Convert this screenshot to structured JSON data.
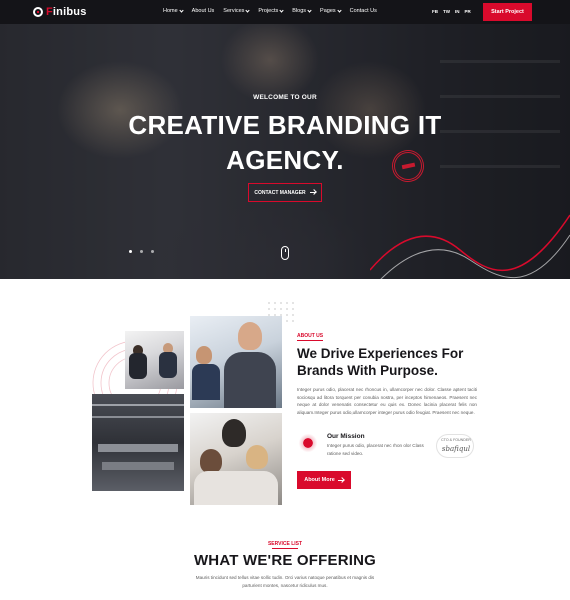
{
  "nav": {
    "brand_prefix": "F",
    "brand_rest": "inibus",
    "menu": [
      {
        "label": "Home",
        "has_dropdown": true
      },
      {
        "label": "About Us",
        "has_dropdown": false
      },
      {
        "label": "Services",
        "has_dropdown": true
      },
      {
        "label": "Projects",
        "has_dropdown": true
      },
      {
        "label": "Blogs",
        "has_dropdown": true
      },
      {
        "label": "Pages",
        "has_dropdown": true
      },
      {
        "label": "Contact Us",
        "has_dropdown": false
      }
    ],
    "social": [
      "FB",
      "TW",
      "IN",
      "PR"
    ],
    "cta_label": "Start Project"
  },
  "hero": {
    "welcome": "WELCOME TO OUR",
    "title_line1": "CREATIVE BRANDING IT",
    "title_line2": "AGENCY.",
    "button_label": "CONTACT MANAGER"
  },
  "about": {
    "tag": "ABOUT US",
    "title_line1": "We Drive Experiences For",
    "title_line2": "Brands With Purpose.",
    "text": "Integer purus odio, placerat nec rhoncus in, ullamcorper nec dolor. Classe aptent taciti sociosqu ad litora torquent per conubia nostra, per inceptos himenaeos. Praesent nec neque at dolor venenatis consectetur eu quis ex. Donec lacinia placerat felis non aliquam.Integer purus odio,ullamcorper integer purus odio feugiat. Praesent nec neque.",
    "mission_title": "Our Mission",
    "mission_text": "Integer purus odio, placerat nec rhon olor Class ratione sed video.",
    "signature_role": "CTO & FOUNDER",
    "signature_name": "sbafiqul",
    "button_label": "About More"
  },
  "services": {
    "tag": "SERVICE LIST",
    "title": "WHAT WE'RE OFFERING",
    "text": "Mauris tincidunt sed tellus vitae sollic tudin. Orci varius natoque penatibus et magnis dis parturient montes, nascetur ridiculus mus."
  },
  "colors": {
    "accent": "#d90a2c",
    "dark": "#17161a",
    "nav_bg": "#141418"
  }
}
